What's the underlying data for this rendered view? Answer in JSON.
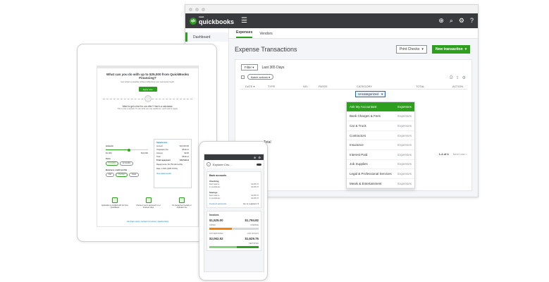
{
  "colors": {
    "brand_green": "#2ca01c",
    "topbar": "#393a3d",
    "link_blue": "#0077c5",
    "overdue_orange": "#ff8000"
  },
  "desktop": {
    "logo": {
      "mark": "qb",
      "intuit": "intuit",
      "name": "quickbooks"
    },
    "sidebar": {
      "items": [
        {
          "label": "Dashboard"
        }
      ]
    },
    "tabs": [
      {
        "label": "Expenses",
        "active": true
      },
      {
        "label": "Vendors",
        "active": false
      }
    ],
    "page_title": "Expense Transactions",
    "print_checks_label": "Print Checks",
    "new_transaction_label": "New transaction",
    "filter_label": "Filter",
    "date_range": "Last 365 Days",
    "batch_actions_label": "Batch actions",
    "columns": [
      "DATE ▾",
      "TYPE",
      "NO.",
      "PAYEE",
      "CATEGORY",
      "TOTAL",
      "ACTION"
    ],
    "category_value": "Uncategorized",
    "total_label": "Total",
    "pager": {
      "text": "1-4 of 4",
      "next": "Next Last >"
    },
    "dropdown": [
      {
        "name": "Ask My Accountant",
        "type": "Expenses",
        "selected": true
      },
      {
        "name": "Bank Charges & Fees",
        "type": "Expenses"
      },
      {
        "name": "Car & Truck",
        "type": "Expenses"
      },
      {
        "name": "Contractors",
        "type": "Expenses"
      },
      {
        "name": "Insurance",
        "type": "Expenses"
      },
      {
        "name": "Interest Paid",
        "type": "Expenses"
      },
      {
        "name": "Job Supplies",
        "type": "Expenses"
      },
      {
        "name": "Legal & Professional Services",
        "type": "Expenses"
      },
      {
        "name": "Meals & Entertainment",
        "type": "Expenses"
      }
    ]
  },
  "tablet": {
    "title": "What can you do with up to $25,000 from QuickBooks Financing?",
    "subtitle": "Get what's possible without affecting your personal credit.",
    "apply_label": "Apply now",
    "calc_title": "Want to get a feel for our offer? Here's a calculator.",
    "calc_sub": "This is only a sample. To see what you may qualify for, you'll need to apply.",
    "amount_label": "Amount",
    "amount_min": "$1,000",
    "amount_max": "$10,000",
    "term_label": "Term",
    "terms": [
      "6 months",
      "12 months"
    ],
    "profile_label": "Business credit profile",
    "profiles": [
      "Fair",
      "Average",
      "Great"
    ],
    "sample": {
      "heading": "Sample loan",
      "rows": [
        {
          "k": "Amount",
          "v": "$10,000.00"
        },
        {
          "k": "Origination fee",
          "v": "$519.14"
        },
        {
          "k": "Interest",
          "v": "$0.00"
        },
        {
          "k": "Total",
          "v": "$519.14"
        },
        {
          "k": "Total repayment",
          "v": "$10,519.14"
        }
      ],
      "repayments": "Repayments: $1,753.19/monthly",
      "rate": "Rate: 1.54% (APR 9.87%)",
      "link": "View detail results"
    },
    "icons": [
      {
        "name": "spreadsheet-icon",
        "text": "Application is prefilled with info from QuickBooks"
      },
      {
        "name": "clock-icon",
        "text": "Choose if you're approved in 1-2 business days"
      },
      {
        "name": "shield-icon",
        "text": "No prepayment penalty or origination fee"
      }
    ],
    "links": "Get Fast Loans  |  Contact Us & Fees  |  Quality FAQs"
  },
  "phone": {
    "title": "Explorer Ciro...",
    "bank_card": {
      "title": "Bank accounts",
      "accounts": [
        {
          "name": "Checking",
          "line1": "Bank balance",
          "line2": "In QuickBooks",
          "v1": "$3,685.76",
          "v2": "$3,685.76"
        },
        {
          "name": "Savings",
          "line1": "Bank balance",
          "line2": "In QuickBooks",
          "v1": "$3,685.76",
          "v2": "$3,685.76"
        }
      ],
      "link": "Connect accounts",
      "link_right": "Go to registers ▾"
    },
    "invoice_card": {
      "title": "Invoices",
      "unpaid_amount": "$1,525.00",
      "unpaid_label": "UNPAID",
      "overdue_amount": "$1,794.82",
      "overdue_label": "OVERDUE",
      "unpaid_fraction": 0.46,
      "paid_amount": "$2,062.52",
      "paid_label": "NOT DEPOSITED",
      "deposited_amount": "$1,629.76",
      "deposited_label": "DEPOSITED",
      "days_label": "LAST 30 DAYS",
      "paid_fraction": 0.56
    }
  }
}
